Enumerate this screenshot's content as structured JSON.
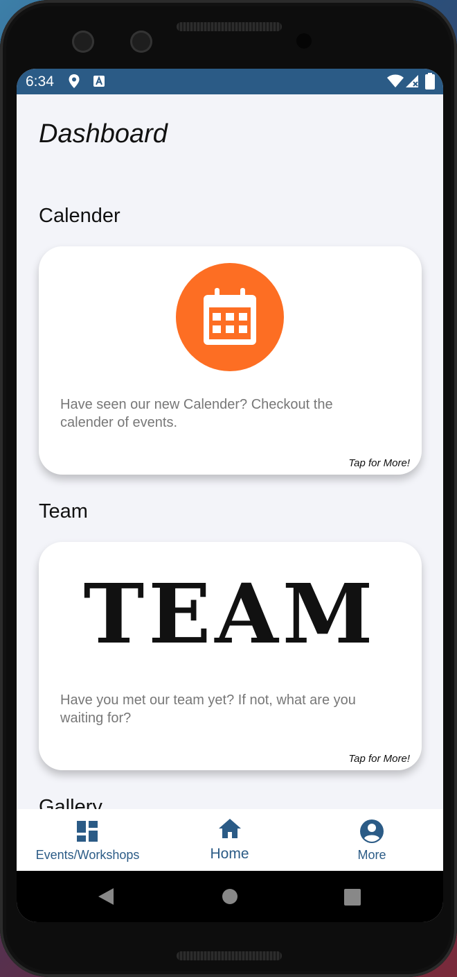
{
  "status_bar": {
    "time": "6:34"
  },
  "page": {
    "title": "Dashboard"
  },
  "sections": [
    {
      "title": "Calender",
      "text": "Have seen our new Calender? Checkout the calender of events.",
      "tap": "Tap for More!"
    },
    {
      "title": "Team",
      "logo_text": "TEAM",
      "text": "Have you met our team yet? If not, what are you waiting for?",
      "tap": "Tap for More!"
    },
    {
      "title": "Gallery"
    }
  ],
  "bottom_nav": [
    {
      "label": "Events/Workshops",
      "icon": "dashboard-icon"
    },
    {
      "label": "Home",
      "icon": "home-icon",
      "active": true
    },
    {
      "label": "More",
      "icon": "account-circle-icon"
    }
  ],
  "colors": {
    "status_bar": "#2b5b86",
    "accent": "#2b5b86",
    "calendar_circle": "#fd6e23"
  }
}
